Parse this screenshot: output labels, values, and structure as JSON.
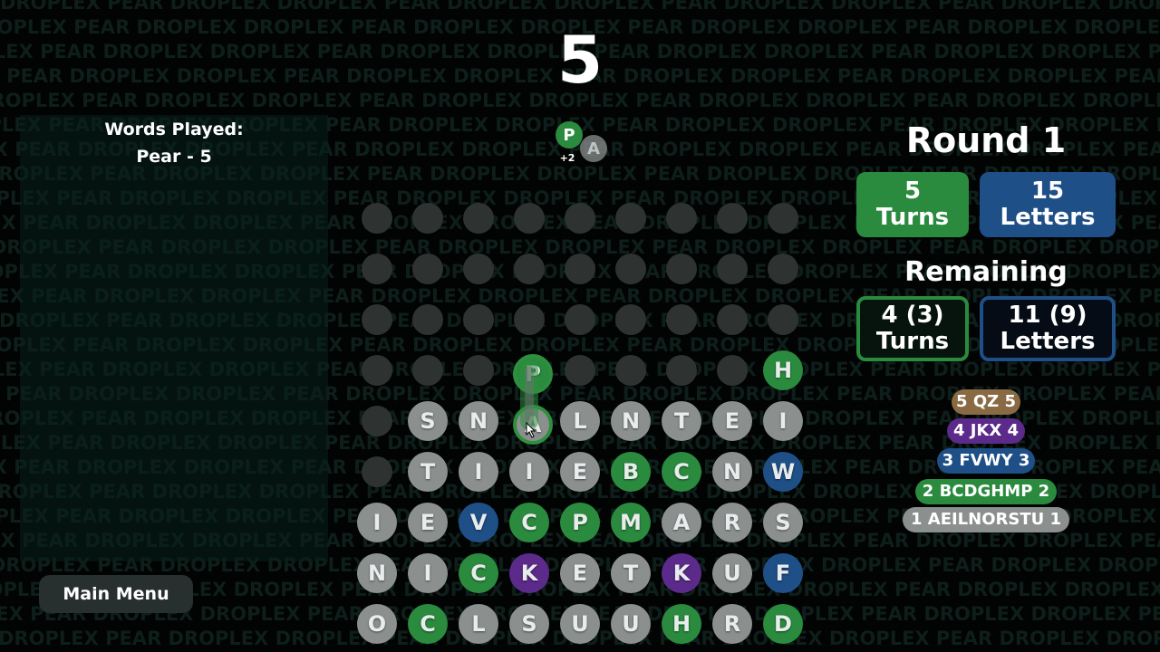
{
  "background_words": [
    "DROPLEX",
    "PEAR"
  ],
  "score": "5",
  "words_panel": {
    "title": "Words Played:",
    "words": [
      "Pear - 5"
    ]
  },
  "main_menu_label": "Main Menu",
  "round": {
    "title": "Round 1",
    "turns": {
      "value": "5",
      "label": "Turns"
    },
    "letters": {
      "value": "15",
      "label": "Letters"
    }
  },
  "remaining": {
    "title": "Remaining",
    "turns": {
      "value": "4 (3)",
      "label": "Turns"
    },
    "letters": {
      "value": "11 (9)",
      "label": "Letters"
    }
  },
  "legend": [
    {
      "text": "5 QZ 5",
      "color": "#8a6a42"
    },
    {
      "text": "4 JKX 4",
      "color": "#5b2a8a"
    },
    {
      "text": "3 FVWY 3",
      "color": "#1f4f87"
    },
    {
      "text": "2 BCDGHMP 2",
      "color": "#2a8a3e"
    },
    {
      "text": "1 AEILNORSTU 1",
      "color": "#8b8f8e"
    }
  ],
  "selection_preview": {
    "letters": [
      "P",
      "A"
    ],
    "bonus": "+2"
  },
  "tile_colors": {
    "gray": "#8b8f8e",
    "green": "#2a8a3e",
    "blue": "#1f4f87",
    "purple": "#5b2a8a",
    "empty": "#2e3331"
  },
  "board": {
    "cols": 9,
    "rows": 9,
    "cells": [
      [
        null,
        null,
        null,
        null,
        null,
        null,
        null,
        null,
        null
      ],
      [
        null,
        null,
        null,
        null,
        null,
        null,
        null,
        null,
        null
      ],
      [
        null,
        null,
        null,
        null,
        null,
        null,
        null,
        null,
        null
      ],
      [
        null,
        null,
        null,
        {
          "l": "P",
          "c": "green",
          "sel": true
        },
        null,
        null,
        null,
        null,
        {
          "l": "H",
          "c": "green"
        }
      ],
      [
        null,
        {
          "l": "S",
          "c": "gray"
        },
        {
          "l": "N",
          "c": "gray"
        },
        {
          "l": "A",
          "c": "gray",
          "sel": true
        },
        {
          "l": "L",
          "c": "gray"
        },
        {
          "l": "N",
          "c": "gray"
        },
        {
          "l": "T",
          "c": "gray"
        },
        {
          "l": "E",
          "c": "gray"
        },
        {
          "l": "I",
          "c": "gray"
        }
      ],
      [
        null,
        {
          "l": "T",
          "c": "gray"
        },
        {
          "l": "I",
          "c": "gray"
        },
        {
          "l": "I",
          "c": "gray"
        },
        {
          "l": "E",
          "c": "gray"
        },
        {
          "l": "B",
          "c": "green"
        },
        {
          "l": "C",
          "c": "green"
        },
        {
          "l": "N",
          "c": "gray"
        },
        {
          "l": "W",
          "c": "blue"
        }
      ],
      [
        {
          "l": "I",
          "c": "gray"
        },
        {
          "l": "E",
          "c": "gray"
        },
        {
          "l": "V",
          "c": "blue"
        },
        {
          "l": "C",
          "c": "green"
        },
        {
          "l": "P",
          "c": "green"
        },
        {
          "l": "M",
          "c": "green"
        },
        {
          "l": "A",
          "c": "gray"
        },
        {
          "l": "R",
          "c": "gray"
        },
        {
          "l": "S",
          "c": "gray"
        }
      ],
      [
        {
          "l": "N",
          "c": "gray"
        },
        {
          "l": "I",
          "c": "gray"
        },
        {
          "l": "C",
          "c": "green"
        },
        {
          "l": "K",
          "c": "purple"
        },
        {
          "l": "E",
          "c": "gray"
        },
        {
          "l": "T",
          "c": "gray"
        },
        {
          "l": "K",
          "c": "purple"
        },
        {
          "l": "U",
          "c": "gray"
        },
        {
          "l": "F",
          "c": "blue"
        }
      ],
      [
        {
          "l": "O",
          "c": "gray"
        },
        {
          "l": "C",
          "c": "green"
        },
        {
          "l": "L",
          "c": "gray"
        },
        {
          "l": "S",
          "c": "gray"
        },
        {
          "l": "U",
          "c": "gray"
        },
        {
          "l": "U",
          "c": "gray"
        },
        {
          "l": "H",
          "c": "green"
        },
        {
          "l": "R",
          "c": "gray"
        },
        {
          "l": "D",
          "c": "green"
        }
      ]
    ]
  }
}
